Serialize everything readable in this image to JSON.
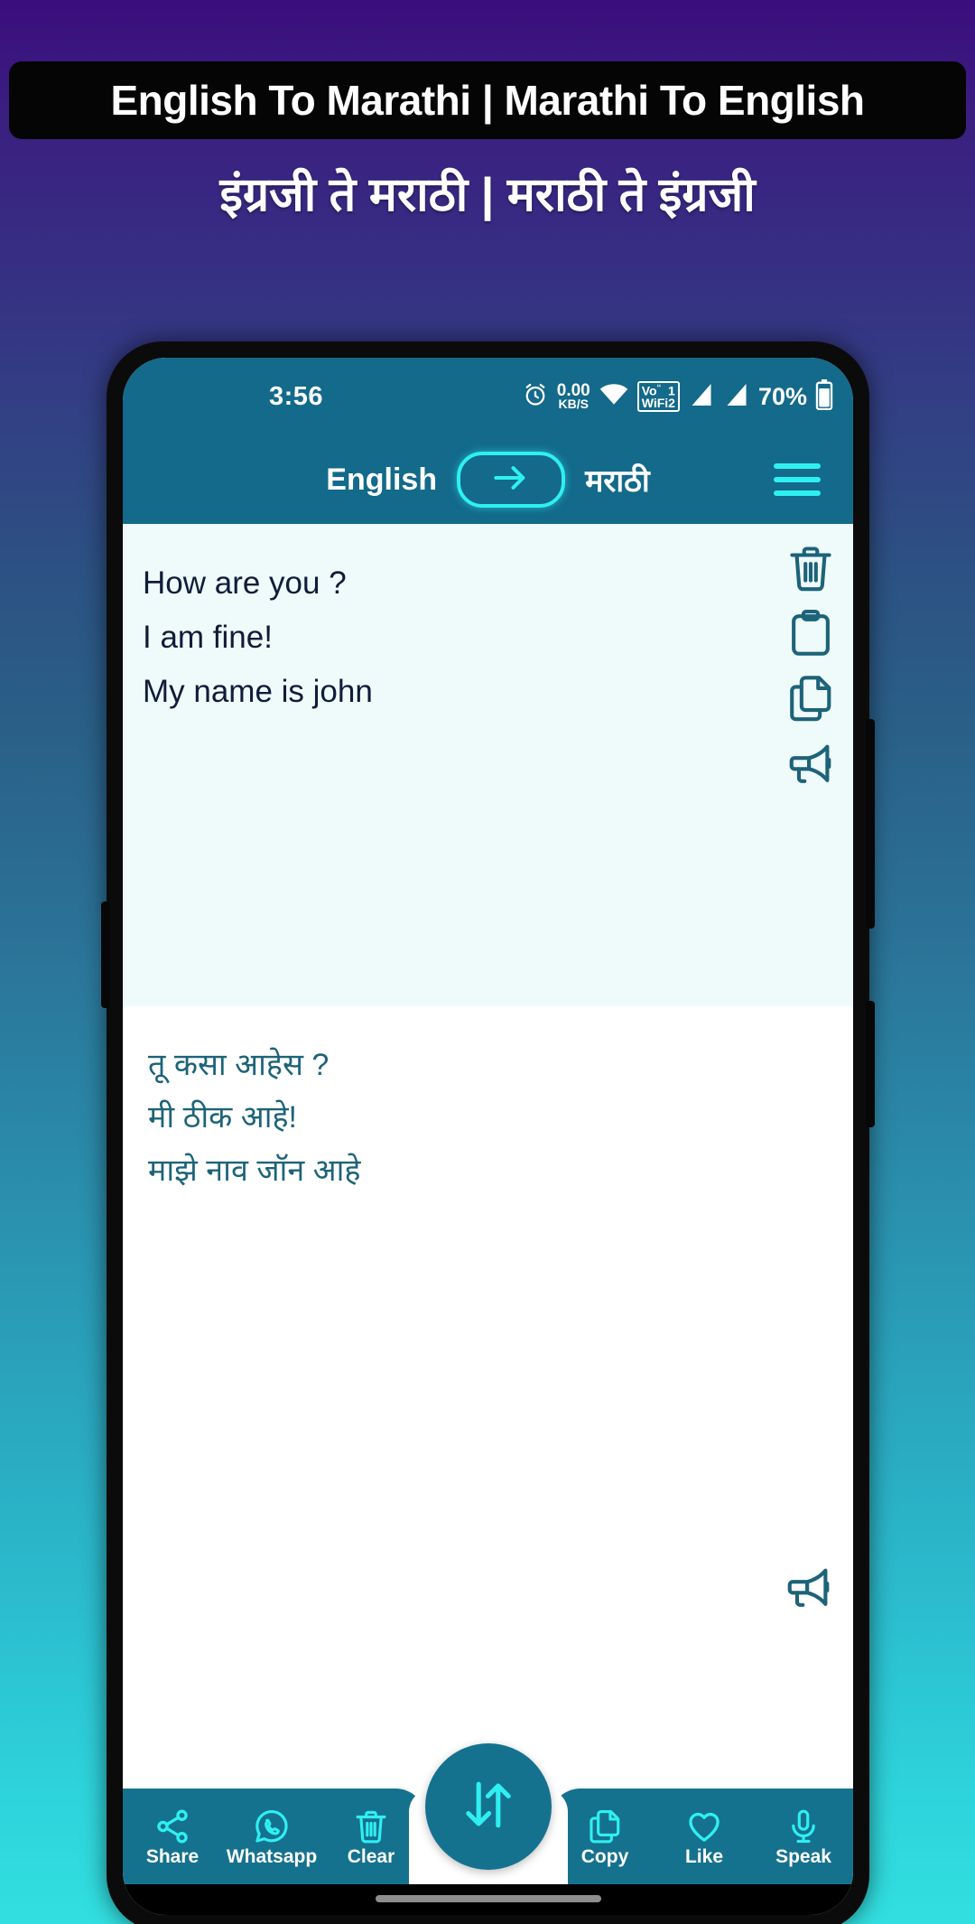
{
  "promo": {
    "title": "English To Marathi | Marathi To English",
    "subtitle": "इंग्रजी ते मराठी |  मराठी ते इंग्रजी"
  },
  "statusbar": {
    "time": "3:56",
    "alarm_icon": "alarm-icon",
    "net_speed_value": "0.00",
    "net_speed_unit": "KB/S",
    "wifi_icon": "wifi-icon",
    "vowifi_line1": "Vo",
    "vowifi_line2": "WiFi",
    "vowifi_sim1": "1",
    "vowifi_sim2": "2",
    "signal_icon_1": "signal-bars-icon",
    "signal_icon_2": "signal-bars-icon",
    "battery_percent": "70%",
    "battery_icon": "battery-icon"
  },
  "toolbar": {
    "source_language": "English",
    "target_language": "मराठी",
    "swap_arrow_icon": "arrow-right-icon",
    "menu_icon": "hamburger-menu-icon"
  },
  "input_pane": {
    "text": "How are you ?\nI am fine!\nMy name is john",
    "actions": [
      {
        "name": "delete-icon",
        "label": "Delete"
      },
      {
        "name": "paste-icon",
        "label": "Paste"
      },
      {
        "name": "copy-icon",
        "label": "Copy"
      },
      {
        "name": "speak-icon",
        "label": "Speak"
      }
    ]
  },
  "output_pane": {
    "text": "तू कसा आहेस ?\n  मी ठीक आहे!\n  माझे नाव जॉन आहे",
    "speak_icon": "speak-icon"
  },
  "bottombar": {
    "left_items": [
      {
        "icon": "share-icon",
        "label": "Share"
      },
      {
        "icon": "whatsapp-icon",
        "label": "Whatsapp"
      },
      {
        "icon": "trash-icon",
        "label": "Clear"
      }
    ],
    "right_items": [
      {
        "icon": "copy-icon",
        "label": "Copy"
      },
      {
        "icon": "heart-icon",
        "label": "Like"
      },
      {
        "icon": "microphone-icon",
        "label": "Speak"
      }
    ],
    "fab_icon": "swap-vertical-icon"
  },
  "colors": {
    "app_teal": "#136a8a",
    "accent_cyan": "#2ff0f0",
    "input_bg": "#effbfa",
    "output_bg": "#ffffff",
    "output_text": "#1d6379",
    "bg_gradient_top": "#3b0d7e",
    "bg_gradient_bottom": "#32dfe0"
  }
}
